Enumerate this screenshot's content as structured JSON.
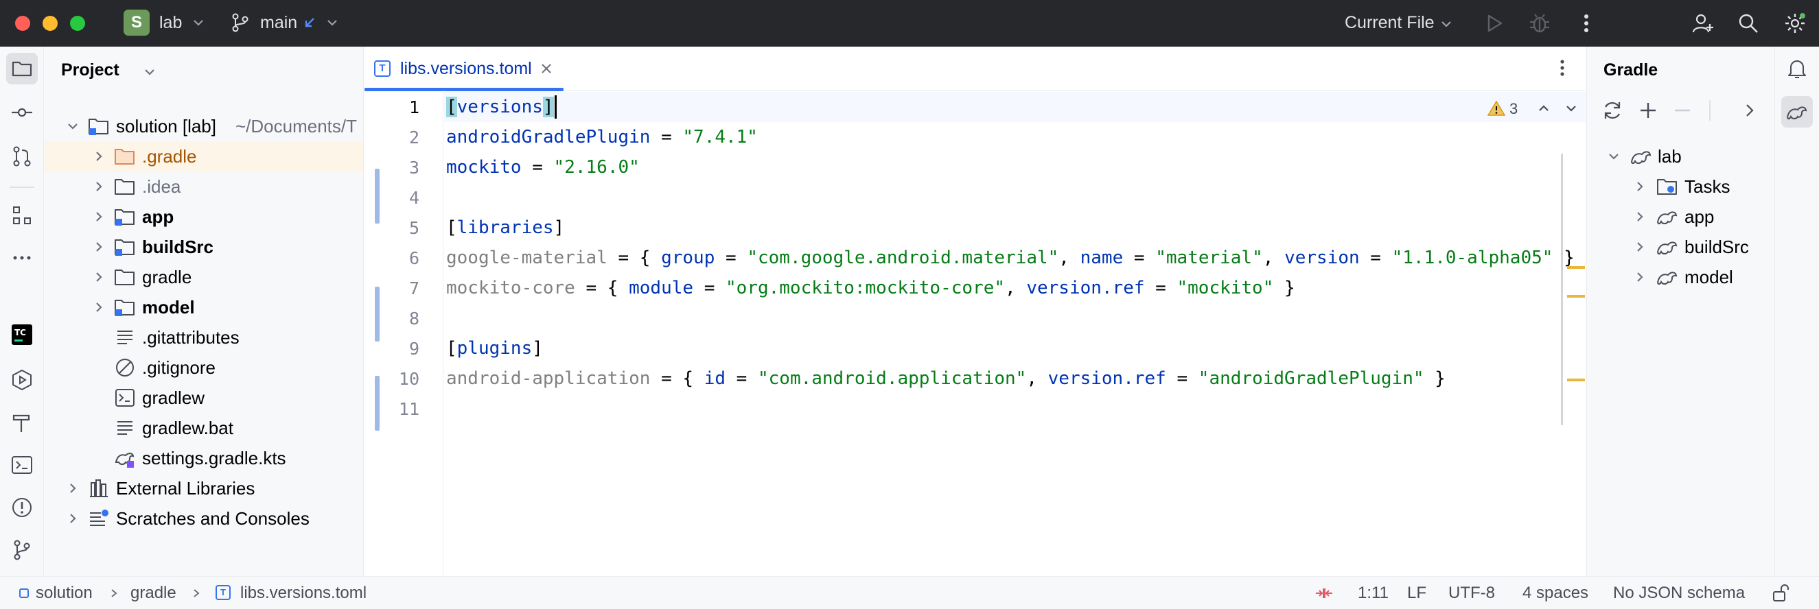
{
  "titlebar": {
    "project_badge": "S",
    "project_name": "lab",
    "branch": "main",
    "run_config": "Current File",
    "colors": {
      "close": "#ff5f57",
      "minimize": "#febc2e",
      "maximize": "#28c840",
      "badge": "#6b9a5b"
    }
  },
  "project_panel": {
    "title": "Project",
    "tree": [
      {
        "label": "solution [lab]",
        "suffix": "~/Documents/T",
        "icon": "module-folder-icon",
        "expanded": true
      },
      {
        "label": ".gradle",
        "icon": "folder-icon"
      },
      {
        "label": ".idea",
        "icon": "folder-icon"
      },
      {
        "label": "app",
        "icon": "module-folder-icon"
      },
      {
        "label": "buildSrc",
        "icon": "module-folder-icon"
      },
      {
        "label": "gradle",
        "icon": "folder-icon"
      },
      {
        "label": "model",
        "icon": "module-folder-icon"
      },
      {
        "label": ".gitattributes",
        "icon": "text-file-icon"
      },
      {
        "label": ".gitignore",
        "icon": "ignore-file-icon"
      },
      {
        "label": "gradlew",
        "icon": "shell-file-icon"
      },
      {
        "label": "gradlew.bat",
        "icon": "text-file-icon"
      },
      {
        "label": "settings.gradle.kts",
        "icon": "gradle-kts-icon"
      },
      {
        "label": "External Libraries",
        "icon": "libraries-icon"
      },
      {
        "label": "Scratches and Consoles",
        "icon": "scratches-icon"
      }
    ]
  },
  "editor": {
    "tab_label": "libs.versions.toml",
    "tab_icon_letter": "T",
    "warning_count": "3",
    "line_numbers": [
      "1",
      "2",
      "3",
      "4",
      "5",
      "6",
      "7",
      "8",
      "9",
      "10",
      "11"
    ],
    "lines": [
      {
        "tokens": [
          [
            "br",
            "["
          ],
          [
            "k",
            "versions"
          ],
          [
            "br",
            "]"
          ]
        ]
      },
      {
        "tokens": [
          [
            "k",
            "androidGradlePlugin"
          ],
          [
            "p",
            " = "
          ],
          [
            "s",
            "\"7.4.1\""
          ]
        ]
      },
      {
        "tokens": [
          [
            "k",
            "mockito"
          ],
          [
            "p",
            " = "
          ],
          [
            "s",
            "\"2.16.0\""
          ]
        ]
      },
      {
        "tokens": []
      },
      {
        "tokens": [
          [
            "p",
            "["
          ],
          [
            "k",
            "libraries"
          ],
          [
            "p",
            "]"
          ]
        ]
      },
      {
        "tokens": [
          [
            "g",
            "google-material"
          ],
          [
            "p",
            " = { "
          ],
          [
            "k",
            "group"
          ],
          [
            "p",
            " = "
          ],
          [
            "s",
            "\"com.google.android.material\""
          ],
          [
            "p",
            ", "
          ],
          [
            "k",
            "name"
          ],
          [
            "p",
            " = "
          ],
          [
            "s",
            "\"material\""
          ],
          [
            "p",
            ", "
          ],
          [
            "k",
            "version"
          ],
          [
            "p",
            " = "
          ],
          [
            "s",
            "\"1.1.0-alpha05\""
          ],
          [
            "p",
            " }"
          ]
        ]
      },
      {
        "tokens": [
          [
            "g",
            "mockito-core"
          ],
          [
            "p",
            " = { "
          ],
          [
            "k",
            "module"
          ],
          [
            "p",
            " = "
          ],
          [
            "s",
            "\"org.mockito:mockito-core\""
          ],
          [
            "p",
            ", "
          ],
          [
            "k",
            "version.ref"
          ],
          [
            "p",
            " = "
          ],
          [
            "s",
            "\"mockito\""
          ],
          [
            "p",
            " }"
          ]
        ]
      },
      {
        "tokens": []
      },
      {
        "tokens": [
          [
            "p",
            "["
          ],
          [
            "k",
            "plugins"
          ],
          [
            "p",
            "]"
          ]
        ]
      },
      {
        "tokens": [
          [
            "g",
            "android-application"
          ],
          [
            "p",
            " = { "
          ],
          [
            "k",
            "id"
          ],
          [
            "p",
            " = "
          ],
          [
            "s",
            "\"com.android.application\""
          ],
          [
            "p",
            ", "
          ],
          [
            "k",
            "version.ref"
          ],
          [
            "p",
            " = "
          ],
          [
            "s",
            "\"androidGradlePlugin\""
          ],
          [
            "p",
            " }"
          ]
        ]
      },
      {
        "tokens": []
      }
    ]
  },
  "gradle_panel": {
    "title": "Gradle",
    "tree": [
      {
        "label": "lab",
        "expanded": true
      },
      {
        "label": "Tasks"
      },
      {
        "label": "app"
      },
      {
        "label": "buildSrc"
      },
      {
        "label": "model"
      }
    ]
  },
  "statusbar": {
    "breadcrumb": [
      "solution",
      "gradle",
      "libs.versions.toml"
    ],
    "position": "1:11",
    "line_sep": "LF",
    "encoding": "UTF-8",
    "indent": "4 spaces",
    "schema": "No JSON schema"
  }
}
